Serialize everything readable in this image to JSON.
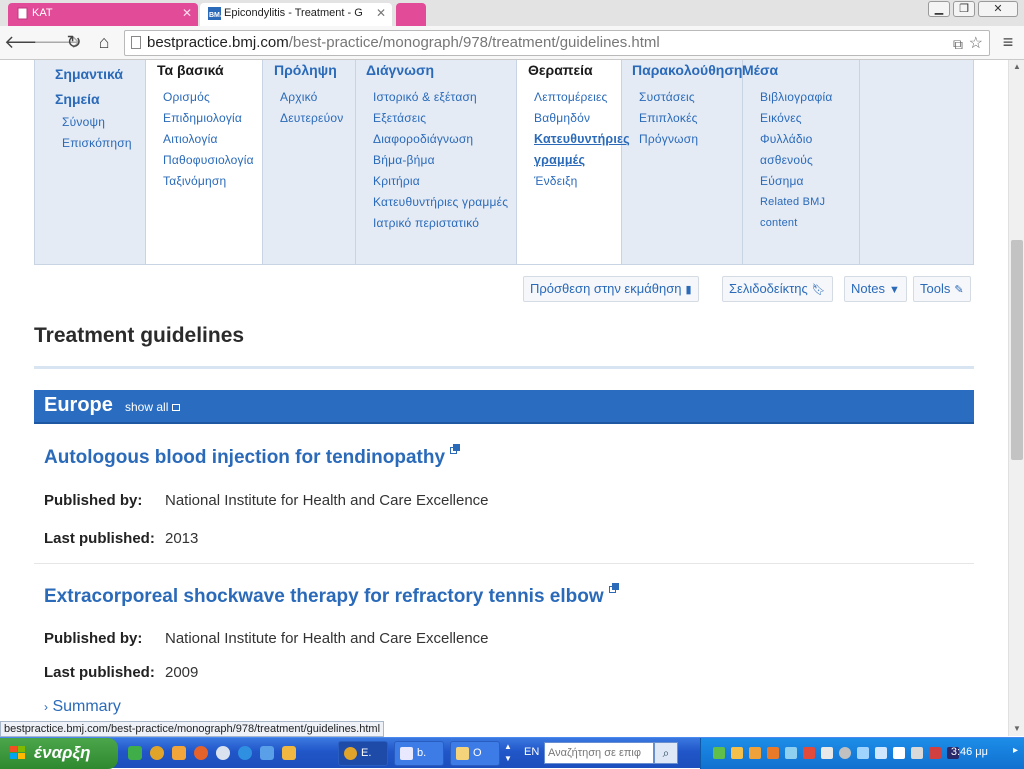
{
  "browser": {
    "tabs": [
      {
        "label": "KAT"
      },
      {
        "label": "Epicondylitis - Treatment - G"
      }
    ],
    "url_host": "bestpractice.bmj.com",
    "url_path": "/best-practice/monograph/978/treatment/guidelines.html",
    "status_url": "bestpractice.bmj.com/best-practice/monograph/978/treatment/guidelines.html"
  },
  "menu": {
    "col1": {
      "heading": "Σημαντικά Σημεία",
      "links": [
        "Σύνοψη",
        "Επισκόπηση"
      ]
    },
    "col2": {
      "heading": "Τα βασικά",
      "links": [
        "Ορισμός",
        "Επιδημιολογία",
        "Αιτιολογία",
        "Παθοφυσιολογία",
        "Ταξινόμηση"
      ]
    },
    "col3": {
      "heading": "Πρόληψη",
      "links": [
        "Αρχικό",
        "Δευτερεύον"
      ]
    },
    "col4": {
      "heading": "Διάγνωση",
      "links": [
        "Ιστορικό & εξέταση",
        "Εξετάσεις",
        "Διαφοροδιάγνωση",
        "Βήμα-βήμα",
        "Κριτήρια",
        "Κατευθυντήριες γραμμές",
        "Ιατρικό περιστατικό"
      ]
    },
    "col5": {
      "heading": "Θεραπεία",
      "links": [
        "Λεπτομέρειες",
        "Βαθμηδόν",
        "Κατευθυντήριες γραμμές",
        "Ένδειξη"
      ]
    },
    "col6": {
      "heading": "Παρακολούθηση",
      "links": [
        "Συστάσεις",
        "Επιπλοκές",
        "Πρόγνωση"
      ]
    },
    "col7": {
      "heading": "Μέσα",
      "links": [
        "Βιβλιογραφία",
        "Εικόνες",
        "Φυλλάδιο ασθενούς",
        "Εύσημα",
        "Related BMJ content"
      ]
    }
  },
  "actions": {
    "add_to_learning": "Πρόσθεση στην εκμάθηση",
    "bookmarks": "Σελιδοδείκτης",
    "notes": "Notes",
    "tools": "Tools"
  },
  "page_title": "Treatment guidelines",
  "region": {
    "name": "Europe",
    "show_all": "show all"
  },
  "labels": {
    "published_by": "Published by:",
    "last_published": "Last published:"
  },
  "guidelines": [
    {
      "title": "Autologous blood injection for tendinopathy",
      "publisher": "National Institute for Health and Care Excellence",
      "year": "2013"
    },
    {
      "title": "Extracorporeal shockwave therapy for refractory tennis elbow",
      "publisher": "National Institute for Health and Care Excellence",
      "year": "2009"
    }
  ],
  "summary_toggle": "Summary",
  "taskbar": {
    "start": "έναρξη",
    "buttons": [
      "E.",
      "b.",
      "O"
    ],
    "lang": "EN",
    "search_placeholder": "Αναζήτηση σε επιφ",
    "clock": "3:46 μμ"
  },
  "colors": {
    "brand": "#2a6ab9",
    "region_bar": "#2a6cc0",
    "tab_pink": "#e14b98"
  }
}
